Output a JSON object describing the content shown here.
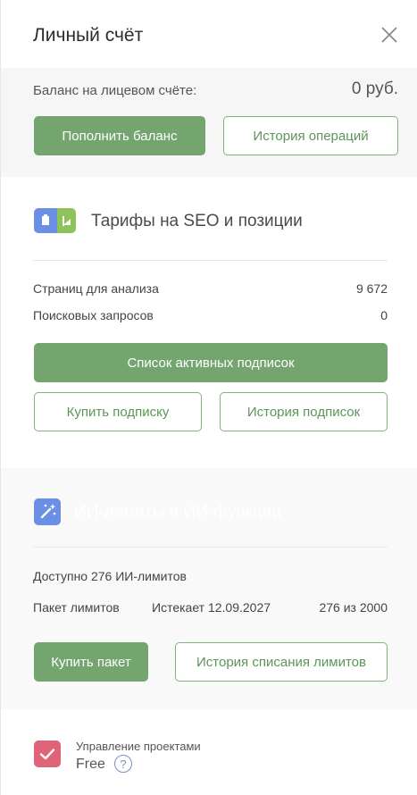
{
  "header": {
    "title": "Личный счёт",
    "close_icon": "close-icon"
  },
  "balance": {
    "label": "Баланс на лицевом счёте:",
    "amount": "0 руб.",
    "topup_button": "Пополнить баланс",
    "history_button": "История операций"
  },
  "seo": {
    "heading": "Тарифы на SEO и позиции",
    "icon": "seo-tariff-icon",
    "rows": [
      {
        "label": "Страниц для анализа",
        "value": "9 672"
      },
      {
        "label": "Поисковых запросов",
        "value": "0"
      }
    ],
    "active_button": "Список активных подписок",
    "buy_button": "Купить подписку",
    "history_button": "История подписок"
  },
  "ai": {
    "heading": "ИИ-лимиты и ИИ-функции",
    "icon": "magic-wand-icon",
    "available": "Доступно 276 ИИ-лимитов",
    "package_label": "Пакет лимитов",
    "package_expires": "Истекает 12.09.2027",
    "package_usage": "276 из 2000",
    "buy_button": "Купить пакет",
    "history_button": "История списания лимитов"
  },
  "footer": {
    "subtitle": "Управление проектами",
    "plan": "Free",
    "help": "?",
    "icon": "checkmark-icon"
  },
  "colors": {
    "accent_green": "#74a56f",
    "outline_green": "#83b37c",
    "check_pink": "#e0637a",
    "icon_blue": "#6c8fe6"
  }
}
